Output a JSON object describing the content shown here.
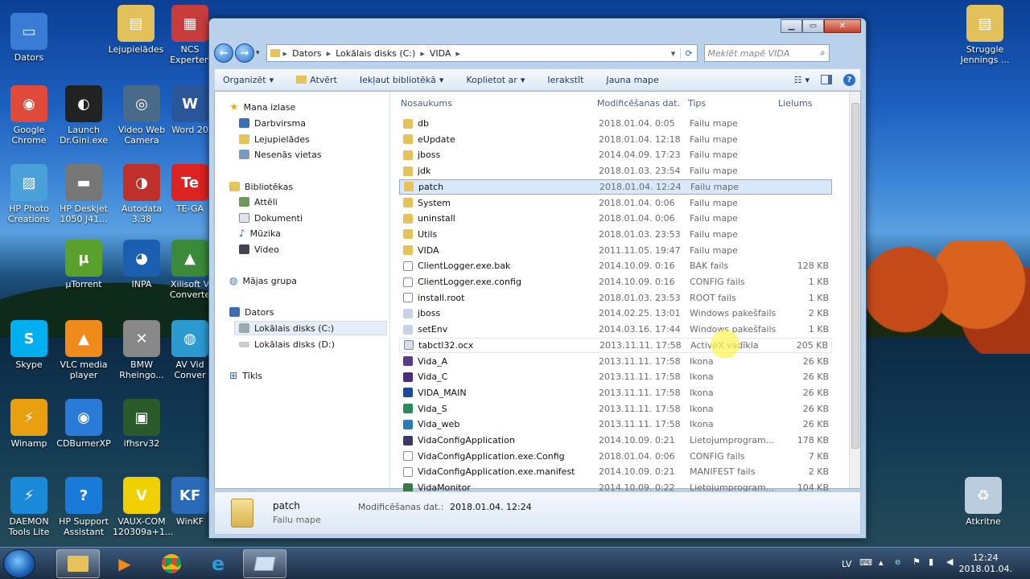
{
  "desktop": {
    "icons": [
      {
        "name": "datorsicon",
        "label": "Dators",
        "color": "#3a7bd5",
        "glyph": "▭"
      },
      {
        "name": "lejupieladesicon",
        "label": "Lejupielādes",
        "color": "#e2c15a",
        "glyph": "▤"
      },
      {
        "name": "ncsicon",
        "label": "NCS\nExperten",
        "color": "#c93c3c",
        "glyph": "▦"
      },
      {
        "name": "chromeicon",
        "label": "Google\nChrome",
        "color": "#e04a3a",
        "glyph": "◉"
      },
      {
        "name": "launchicon",
        "label": "Launch\nDr.Gini.exe",
        "color": "#222",
        "glyph": "◐"
      },
      {
        "name": "webcamicon",
        "label": "Video Web\nCamera",
        "color": "#4a6a8a",
        "glyph": "◎"
      },
      {
        "name": "wordicon",
        "label": "Word 20",
        "color": "#2b579a",
        "glyph": "W"
      },
      {
        "name": "hpphotoicon",
        "label": "HP Photo\nCreations",
        "color": "#4aa0d8",
        "glyph": "▨"
      },
      {
        "name": "hpdeskjeticon",
        "label": "HP Deskjet\n1050 J41...",
        "color": "#777",
        "glyph": "▬"
      },
      {
        "name": "autodataicon",
        "label": "Autodata\n3.38",
        "color": "#c0302a",
        "glyph": "◑"
      },
      {
        "name": "teicon",
        "label": "TE-GA",
        "color": "#d22",
        "glyph": "Te"
      },
      {
        "name": "utorrenticon",
        "label": "µTorrent",
        "color": "#5aa02c",
        "glyph": "µ"
      },
      {
        "name": "inpaicon",
        "label": "INPA",
        "color": "#1a5fb0",
        "glyph": "◕"
      },
      {
        "name": "xilisofticon",
        "label": "Xilisoft V\nConverte",
        "color": "#3a8a3a",
        "glyph": "▲"
      },
      {
        "name": "skypeicon",
        "label": "Skype",
        "color": "#00aff0",
        "glyph": "S"
      },
      {
        "name": "vlcicon",
        "label": "VLC media\nplayer",
        "color": "#f08a1a",
        "glyph": "▲"
      },
      {
        "name": "bmwrheingoldicon",
        "label": "BMW\nRheingo...",
        "color": "#888",
        "glyph": "✕"
      },
      {
        "name": "avvideoicon",
        "label": "AV Vid\nConver",
        "color": "#2a9ad0",
        "glyph": "◍"
      },
      {
        "name": "winampicon",
        "label": "Winamp",
        "color": "#e8a010",
        "glyph": "⚡"
      },
      {
        "name": "cdburnericon",
        "label": "CDBurnerXP",
        "color": "#2a7ad8",
        "glyph": "◉"
      },
      {
        "name": "ifhsrvicon",
        "label": "ifhsrv32",
        "color": "#2a5a2a",
        "glyph": "▣"
      },
      {
        "name": "daemonicon",
        "label": "DAEMON\nTools Lite",
        "color": "#1a8ad8",
        "glyph": "⚡"
      },
      {
        "name": "hpsupporticon",
        "label": "HP Support\nAssistant",
        "color": "#1a7ad8",
        "glyph": "?"
      },
      {
        "name": "vauxicon",
        "label": "VAUX-COM\n120309a+1...",
        "color": "#f0d000",
        "glyph": "V"
      },
      {
        "name": "winkfpticon",
        "label": "WinKF",
        "color": "#2a6ab8",
        "glyph": "KF"
      },
      {
        "name": "strugglefolder",
        "label": "Struggle\nJennings ...",
        "color": "#e2c15a",
        "glyph": "▤"
      },
      {
        "name": "recyclebin",
        "label": "Atkritne",
        "color": "#bcd",
        "glyph": "♻"
      }
    ]
  },
  "window": {
    "address": {
      "crumbs": [
        "Dators",
        "Lokālais disks (C:)",
        "VIDA"
      ],
      "search_placeholder": "Meklēt mapē VIDA"
    },
    "toolbar": {
      "organize": "Organizēt",
      "open": "Atvērt",
      "include_library": "Iekļaut bibliotēkā",
      "share": "Koplietot ar",
      "burn": "Ierakstīt",
      "new_folder": "Jauna mape"
    },
    "nav": {
      "favorites": "Mana izlase",
      "desktop": "Darbvirsma",
      "downloads": "Lejupielādes",
      "recent": "Nesenās vietas",
      "libraries": "Bibliotēkas",
      "pictures": "Attēli",
      "documents": "Dokumenti",
      "music": "Mūzika",
      "videos": "Video",
      "homegroup": "Mājas grupa",
      "computer": "Dators",
      "disk_c": "Lokālais disks (C:)",
      "disk_d": "Lokālais disks (D:)",
      "network": "Tīkls"
    },
    "columns": {
      "name": "Nosaukums",
      "modified": "Modificēšanas dat.",
      "type": "Tips",
      "size": "Lielums"
    },
    "files": [
      {
        "name": "db",
        "date": "2018.01.04. 0:05",
        "type": "Failu mape",
        "size": "",
        "kind": "folder"
      },
      {
        "name": "eUpdate",
        "date": "2018.01.04. 12:18",
        "type": "Failu mape",
        "size": "",
        "kind": "folder"
      },
      {
        "name": "jboss",
        "date": "2014.04.09. 17:23",
        "type": "Failu mape",
        "size": "",
        "kind": "folder"
      },
      {
        "name": "jdk",
        "date": "2018.01.03. 23:54",
        "type": "Failu mape",
        "size": "",
        "kind": "folder"
      },
      {
        "name": "patch",
        "date": "2018.01.04. 12:24",
        "type": "Failu mape",
        "size": "",
        "kind": "folder",
        "selected": true
      },
      {
        "name": "System",
        "date": "2018.01.04. 0:06",
        "type": "Failu mape",
        "size": "",
        "kind": "folder"
      },
      {
        "name": "uninstall",
        "date": "2018.01.04. 0:06",
        "type": "Failu mape",
        "size": "",
        "kind": "folder"
      },
      {
        "name": "Utils",
        "date": "2018.01.03. 23:53",
        "type": "Failu mape",
        "size": "",
        "kind": "folder"
      },
      {
        "name": "VIDA",
        "date": "2011.11.05. 19:47",
        "type": "Failu mape",
        "size": "",
        "kind": "folder"
      },
      {
        "name": "ClientLogger.exe.bak",
        "date": "2014.10.09. 0:16",
        "type": "BAK fails",
        "size": "128 KB",
        "kind": "file"
      },
      {
        "name": "ClientLogger.exe.config",
        "date": "2014.10.09. 0:16",
        "type": "CONFIG fails",
        "size": "1 KB",
        "kind": "file"
      },
      {
        "name": "install.root",
        "date": "2018.01.03. 23:53",
        "type": "ROOT fails",
        "size": "1 KB",
        "kind": "file"
      },
      {
        "name": "jboss",
        "date": "2014.02.25. 13:01",
        "type": "Windows pakešfails",
        "size": "2 KB",
        "kind": "batch"
      },
      {
        "name": "setEnv",
        "date": "2014.03.16. 17:44",
        "type": "Windows pakešfails",
        "size": "1 KB",
        "kind": "batch"
      },
      {
        "name": "tabctl32.ocx",
        "date": "2013.11.11. 17:58",
        "type": "ActiveX vadīkla",
        "size": "205 KB",
        "kind": "ocx",
        "hover": true
      },
      {
        "name": "Vida_A",
        "date": "2013.11.11. 17:58",
        "type": "Ikona",
        "size": "26 KB",
        "kind": "icon_a"
      },
      {
        "name": "Vida_C",
        "date": "2013.11.11. 17:58",
        "type": "Ikona",
        "size": "26 KB",
        "kind": "icon_c"
      },
      {
        "name": "VIDA_MAIN",
        "date": "2013.11.11. 17:58",
        "type": "Ikona",
        "size": "26 KB",
        "kind": "icon_main"
      },
      {
        "name": "Vida_S",
        "date": "2013.11.11. 17:58",
        "type": "Ikona",
        "size": "26 KB",
        "kind": "icon_s"
      },
      {
        "name": "Vida_web",
        "date": "2013.11.11. 17:58",
        "type": "Ikona",
        "size": "26 KB",
        "kind": "icon_web"
      },
      {
        "name": "VidaConfigApplication",
        "date": "2014.10.09. 0:21",
        "type": "Lietojumprogram...",
        "size": "178 KB",
        "kind": "app"
      },
      {
        "name": "VidaConfigApplication.exe.Config",
        "date": "2018.01.04. 0:06",
        "type": "CONFIG fails",
        "size": "7 KB",
        "kind": "file"
      },
      {
        "name": "VidaConfigApplication.exe.manifest",
        "date": "2014.10.09. 0:21",
        "type": "MANIFEST fails",
        "size": "2 KB",
        "kind": "file"
      },
      {
        "name": "VidaMonitor",
        "date": "2014.10.09. 0:22",
        "type": "Lietojumprogram...",
        "size": "104 KB",
        "kind": "app2"
      }
    ],
    "details": {
      "name": "patch",
      "kind": "Failu mape",
      "modified_label": "Modificēšanas dat.:",
      "modified_value": "2018.01.04. 12:24"
    }
  },
  "taskbar": {
    "lang": "LV",
    "time": "12:24",
    "date": "2018.01.04."
  },
  "colors": {
    "folder": "#e6c35a",
    "selection": "#d9e8fb",
    "accent": "#1a5fb0"
  }
}
